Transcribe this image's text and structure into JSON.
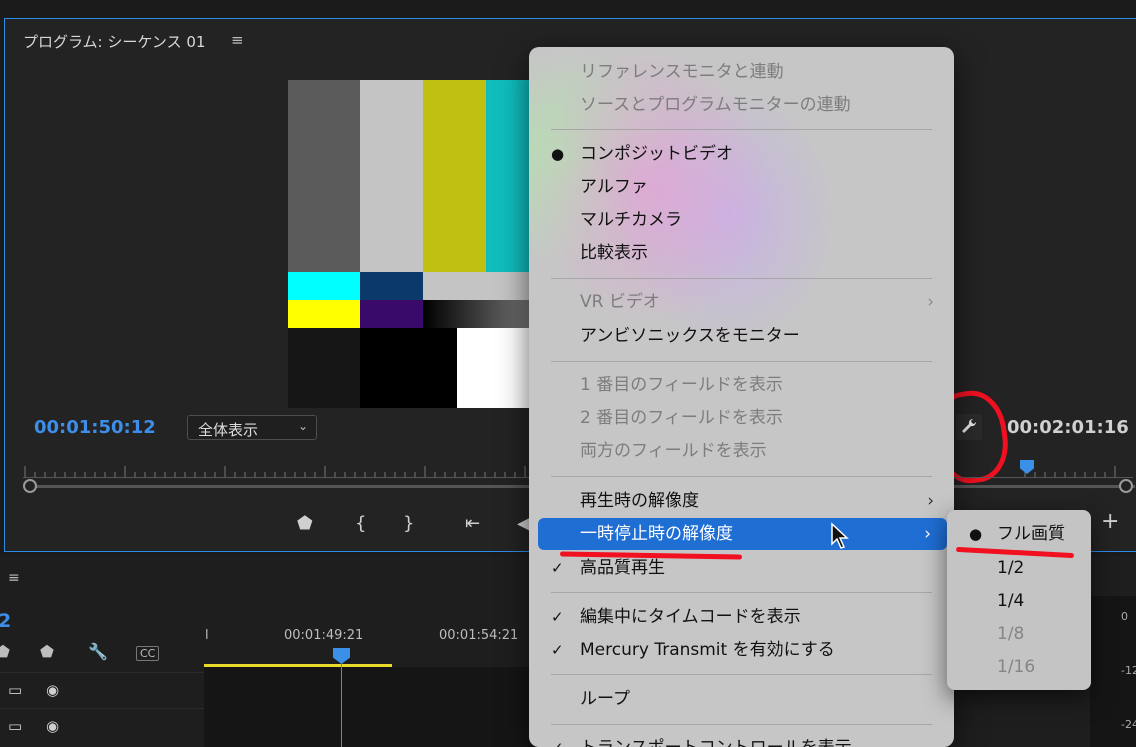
{
  "monitor": {
    "title": "プログラム: シーケンス 01",
    "menu_icon": "≡",
    "timecode_current": "00:01:50:12",
    "timecode_duration": "00:02:01:16",
    "fit_select": "全体表示"
  },
  "menu": {
    "items": [
      {
        "label": "リファレンスモニタと連動",
        "disabled": true
      },
      {
        "label": "ソースとプログラムモニターの連動",
        "disabled": true
      },
      {
        "label": "コンポジットビデオ",
        "mark": "●"
      },
      {
        "label": "アルファ"
      },
      {
        "label": "マルチカメラ"
      },
      {
        "label": "比較表示"
      },
      {
        "label": "VR ビデオ",
        "disabled": true,
        "arrow": "›"
      },
      {
        "label": "アンビソニックスをモニター"
      },
      {
        "label": "1 番目のフィールドを表示",
        "disabled": true
      },
      {
        "label": "2 番目のフィールドを表示",
        "disabled": true
      },
      {
        "label": "両方のフィールドを表示",
        "disabled": true
      },
      {
        "label": "再生時の解像度",
        "arrow": "›"
      },
      {
        "label": "一時停止時の解像度",
        "arrow": "›",
        "highlighted": true
      },
      {
        "label": "高品質再生",
        "mark": "✓"
      },
      {
        "label": "編集中にタイムコードを表示",
        "mark": "✓"
      },
      {
        "label": "Mercury Transmit を有効にする",
        "mark": "✓"
      },
      {
        "label": "ループ"
      },
      {
        "label": "トランスポートコントロールを表示",
        "mark": "✓"
      }
    ]
  },
  "submenu": {
    "items": [
      {
        "label": "フル画質",
        "mark": "●"
      },
      {
        "label": "1/2"
      },
      {
        "label": "1/4"
      },
      {
        "label": "1/8",
        "disabled": true
      },
      {
        "label": "1/16",
        "disabled": true
      }
    ]
  },
  "timeline": {
    "menu_icon": "≡",
    "sequence_num": "2",
    "time_start": "l",
    "time_1": "00:01:49:21",
    "time_2": "00:01:54:21",
    "meter_labels": [
      "0",
      "-12",
      "-24"
    ]
  },
  "colors": {
    "accent": "#2d8ceb",
    "highlight": "#1f6ed4",
    "annotation": "#f01020",
    "timecode": "#3d8ee8"
  }
}
